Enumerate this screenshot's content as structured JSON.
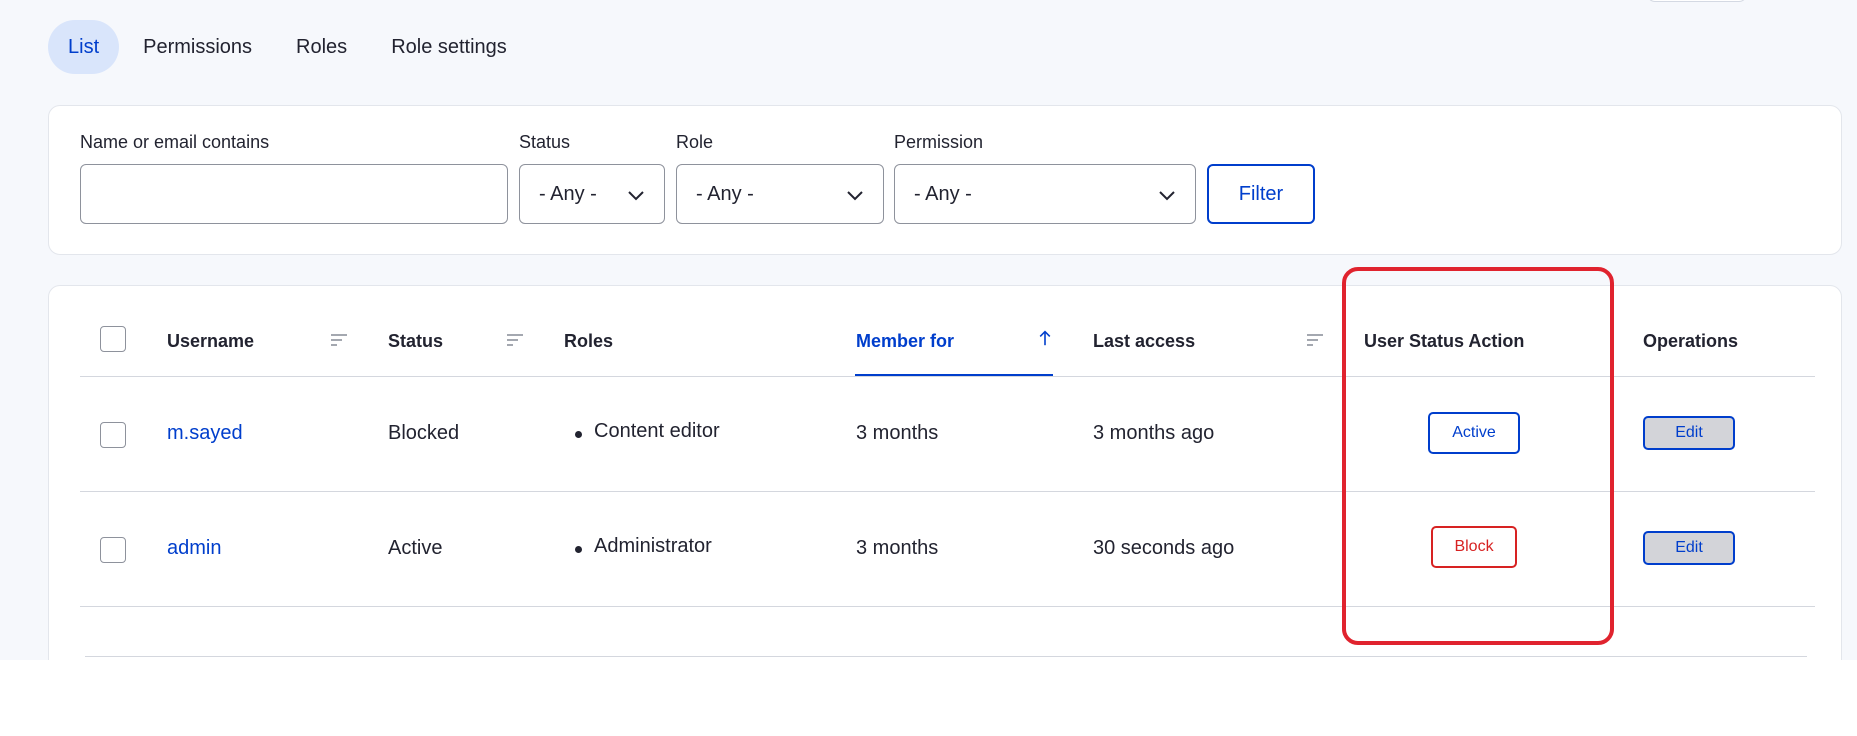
{
  "tabs": [
    {
      "label": "List",
      "active": true
    },
    {
      "label": "Permissions",
      "active": false
    },
    {
      "label": "Roles",
      "active": false
    },
    {
      "label": "Role settings",
      "active": false
    }
  ],
  "filters": {
    "name_label": "Name or email contains",
    "name_value": "",
    "status_label": "Status",
    "status_value": "- Any -",
    "role_label": "Role",
    "role_value": "- Any -",
    "permission_label": "Permission",
    "permission_value": "- Any -",
    "filter_button": "Filter"
  },
  "table": {
    "columns": {
      "username": "Username",
      "status": "Status",
      "roles": "Roles",
      "member_for": "Member for",
      "last_access": "Last access",
      "user_status_action": "User Status Action",
      "operations": "Operations"
    },
    "rows": [
      {
        "username": "m.sayed",
        "status": "Blocked",
        "role": "Content editor",
        "member_for": "3 months",
        "last_access": "3 months ago",
        "action": "Active",
        "operation": "Edit"
      },
      {
        "username": "admin",
        "status": "Active",
        "role": "Administrator",
        "member_for": "3 months",
        "last_access": "30 seconds ago",
        "action": "Block",
        "operation": "Edit"
      }
    ]
  },
  "colors": {
    "accent": "#003ecc",
    "danger": "#d72222",
    "highlight": "#e0232e",
    "active_tab_bg": "#d9e5fb"
  }
}
